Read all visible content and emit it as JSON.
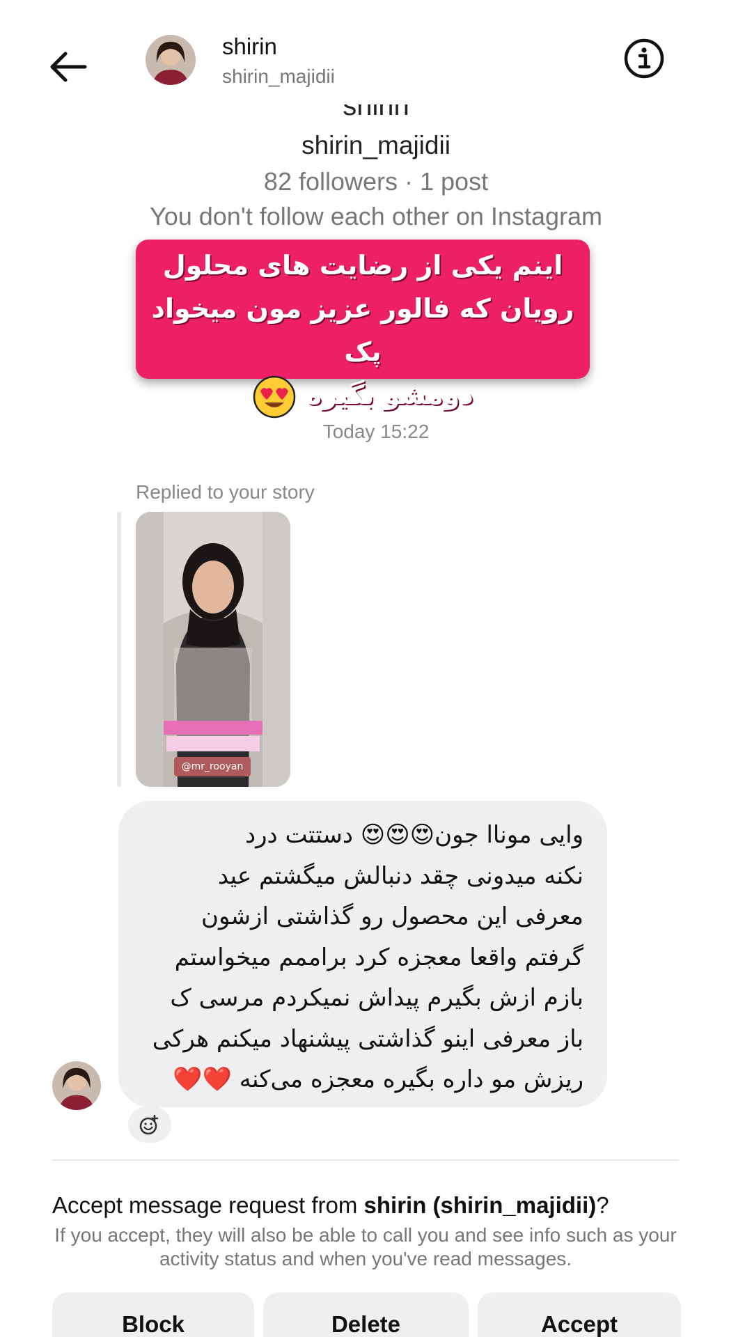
{
  "header": {
    "name": "shirin",
    "username": "shirin_majidii",
    "back_icon": "arrow-left-icon",
    "info_icon": "info-circle-icon"
  },
  "profile": {
    "name_cut": "shirin",
    "username": "shirin_majidii",
    "stats": "82 followers · 1 post",
    "relationship": "You don't follow each other on Instagram"
  },
  "promo": {
    "line1": "اینم یکی از رضایت های محلول",
    "line2": "رویان که فالور عزیز مون میخواد پک",
    "line3": "دومشو بگیره"
  },
  "thread": {
    "timestamp": "Today 15:22",
    "replied_label": "Replied to your story",
    "story_tag": "@mr_rooyan",
    "message": "وایی موناا جون😍😍😍 دستتت درد\nنکنه میدونی چقد دنبالش میگشتم عید\nمعرفی این محصول رو گذاشتی ازشون\nگرفتم واقعا معجزه کرد براممم میخواستم\nبازم ازش بگیرم پیداش نمیکردم مرسی ک\nباز معرفی اینو گذاشتی پیشنهاد میکنم هرکی\nریزش مو داره بگیره معجزه می‌کنه ❤️❤️",
    "react_icon": "add-reaction-icon"
  },
  "request": {
    "title_prefix": "Accept message request from ",
    "title_name": "shirin (shirin_majidii)",
    "title_suffix": "?",
    "description": "If you accept, they will also be able to call you and see info such as your activity status and when you've read messages.",
    "block_label": "Block",
    "delete_label": "Delete",
    "accept_label": "Accept"
  },
  "colors": {
    "promo_bg": "#ec1f67",
    "bubble_bg": "#efeff1",
    "muted_text": "#777777"
  }
}
